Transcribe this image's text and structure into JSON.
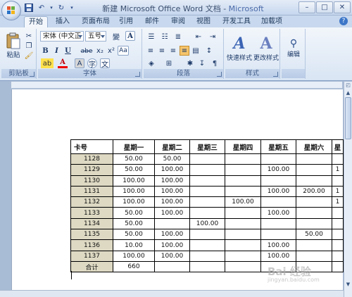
{
  "window": {
    "title": "新建 Microsoft Office Word 文档 - ",
    "app_name": "Microsoft Word",
    "controls": [
      "–",
      "□",
      "✕"
    ]
  },
  "tabs": [
    "开始",
    "插入",
    "页面布局",
    "引用",
    "邮件",
    "审阅",
    "视图",
    "开发工具",
    "加载项"
  ],
  "ribbon": {
    "clipboard": {
      "label": "剪贴板",
      "paste": "粘贴"
    },
    "font": {
      "label": "字体",
      "font_name": "宋体 (中文正",
      "font_size": "五号",
      "wen": "變",
      "A_box": "A",
      "B": "B",
      "I": "I",
      "U": "U",
      "abe": "abe",
      "x2": "x₂",
      "x2s": "x²",
      "Aa": "Aa",
      "A_color": "A",
      "A_small": "A",
      "wen2": "文",
      "circle": "字"
    },
    "paragraph": {
      "label": "段落"
    },
    "styles": {
      "label": "样式",
      "quick": "快速样式",
      "change": "更改样式"
    },
    "edit": {
      "label": "编辑",
      "name": "编辑"
    }
  },
  "table": {
    "headers": [
      "卡号",
      "星期一",
      "星期二",
      "星期三",
      "星期四",
      "星期五",
      "星期六",
      "星"
    ],
    "rows": [
      [
        "1128",
        "50.00",
        "50.00",
        "",
        "",
        "",
        "",
        ""
      ],
      [
        "1129",
        "50.00",
        "100.00",
        "",
        "",
        "100.00",
        "",
        "1"
      ],
      [
        "1130",
        "100.00",
        "100.00",
        "",
        "",
        "",
        "",
        ""
      ],
      [
        "1131",
        "100.00",
        "100.00",
        "",
        "",
        "100.00",
        "200.00",
        "1"
      ],
      [
        "1132",
        "100.00",
        "100.00",
        "",
        "100.00",
        "",
        "",
        "1"
      ],
      [
        "1133",
        "50.00",
        "100.00",
        "",
        "",
        "100.00",
        "",
        ""
      ],
      [
        "1134",
        "50.00",
        "",
        "100.00",
        "",
        "",
        "",
        ""
      ],
      [
        "1135",
        "50.00",
        "100.00",
        "",
        "",
        "",
        "50.00",
        ""
      ],
      [
        "1136",
        "10.00",
        "100.00",
        "",
        "",
        "100.00",
        "",
        ""
      ],
      [
        "1137",
        "100.00",
        "100.00",
        "",
        "",
        "100.00",
        "",
        ""
      ],
      [
        "合计",
        "660",
        "",
        "",
        "",
        "",
        "",
        ""
      ]
    ]
  },
  "watermark": {
    "main": "Bai 经验",
    "sub": "jingyan.baidu.com"
  }
}
